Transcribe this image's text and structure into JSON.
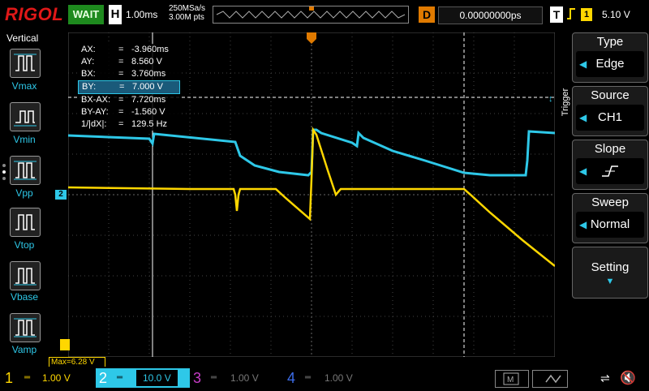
{
  "topbar": {
    "logo": "RIGOL",
    "run_state": "WAIT",
    "h_label": "H",
    "timebase": "1.00ms",
    "sample_rate": "250MSa/s",
    "memory_depth": "3.00M pts",
    "d_label": "D",
    "delay": "0.00000000ps",
    "t_label": "T",
    "trigger_source": "1",
    "trigger_level": "5.10 V"
  },
  "left_panel": {
    "title": "Vertical",
    "items": [
      {
        "label": "Vmax"
      },
      {
        "label": "Vmin"
      },
      {
        "label": "Vpp"
      },
      {
        "label": "Vtop"
      },
      {
        "label": "Vbase"
      },
      {
        "label": "Vamp"
      }
    ]
  },
  "cursor_table": {
    "rows": [
      {
        "key": "AX:",
        "value": "-3.960ms"
      },
      {
        "key": "AY:",
        "value": "8.560 V"
      },
      {
        "key": "BX:",
        "value": "3.760ms"
      },
      {
        "key": "BY:",
        "value": "7.000 V"
      },
      {
        "key": "BX-AX:",
        "value": "7.720ms"
      },
      {
        "key": "BY-AY:",
        "value": "-1.560 V"
      },
      {
        "key": "1/|dX|:",
        "value": "129.5 Hz"
      }
    ],
    "equals": "="
  },
  "right_panel": {
    "side_label": "Trigger",
    "menus": [
      {
        "title": "Type",
        "value": "Edge"
      },
      {
        "title": "Source",
        "value": "CH1"
      },
      {
        "title": "Slope",
        "value": ""
      },
      {
        "title": "Sweep",
        "value": "Normal"
      },
      {
        "title": "Setting",
        "value": ""
      }
    ]
  },
  "measurement": {
    "text": "Max=6.28 V"
  },
  "channel_markers": {
    "ch2": "2"
  },
  "channels": [
    {
      "num": "1",
      "scale": "1.00 V",
      "color": "#ffd700"
    },
    {
      "num": "2",
      "scale": "10.0 V",
      "color": "#2ec8e8"
    },
    {
      "num": "3",
      "scale": "1.00 V",
      "color": "#c83cc8"
    },
    {
      "num": "4",
      "scale": "1.00 V",
      "color": "#3c6ce8"
    }
  ],
  "colors": {
    "ch1": "#ffd700",
    "ch2": "#2ec8e8",
    "trigger_orange": "#e07a00",
    "run_green": "#1e8a1e"
  }
}
